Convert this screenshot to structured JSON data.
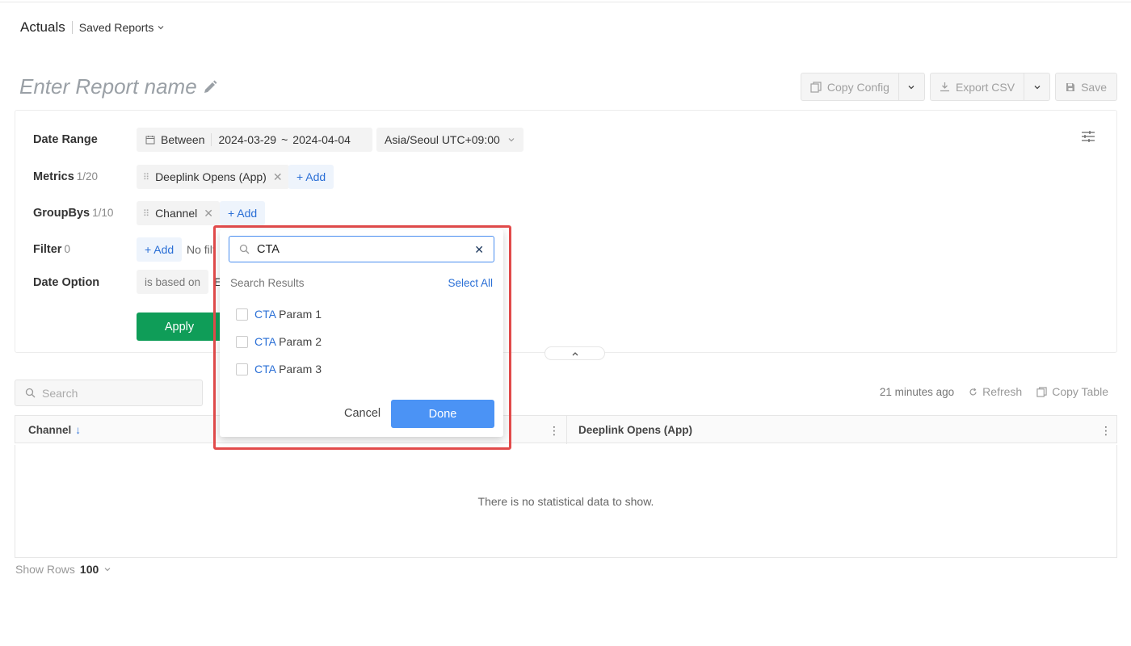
{
  "header": {
    "title": "Actuals",
    "saved_reports": "Saved Reports"
  },
  "report": {
    "name_placeholder": "Enter Report name"
  },
  "toolbar": {
    "copy_config": "Copy Config",
    "export_csv": "Export CSV",
    "save": "Save"
  },
  "config": {
    "date_range": {
      "label": "Date Range",
      "mode": "Between",
      "start": "2024-03-29",
      "tilde": "~",
      "end": "2024-04-04",
      "timezone": "Asia/Seoul UTC+09:00"
    },
    "metrics": {
      "label": "Metrics",
      "count": "1/20",
      "items": [
        "Deeplink Opens (App)"
      ],
      "add": "+ Add"
    },
    "groupbys": {
      "label": "GroupBys",
      "count": "1/10",
      "items": [
        "Channel"
      ],
      "add": "+ Add"
    },
    "filter": {
      "label": "Filter",
      "count": "0",
      "add": "+ Add",
      "empty": "No filt"
    },
    "date_option": {
      "label": "Date Option",
      "based_on": "is based on",
      "value": "E"
    },
    "apply": "Apply"
  },
  "table": {
    "search_placeholder": "Search",
    "updated": "21 minutes ago",
    "refresh": "Refresh",
    "copy_table": "Copy Table",
    "columns": [
      "Channel",
      "Deeplink Opens (App)"
    ],
    "sort_indicator": "↓",
    "empty": "There is no statistical data to show.",
    "show_rows_label": "Show Rows",
    "show_rows_value": "100"
  },
  "popover": {
    "search_value": "CTA",
    "subtitle": "Search Results",
    "select_all": "Select All",
    "options": [
      {
        "match": "CTA",
        "rest": "Param 1"
      },
      {
        "match": "CTA",
        "rest": "Param 2"
      },
      {
        "match": "CTA",
        "rest": "Param 3"
      }
    ],
    "cancel": "Cancel",
    "done": "Done"
  },
  "colors": {
    "primary_blue": "#4b93f5",
    "link_blue": "#2a6fd6",
    "apply_green": "#0f9d58",
    "highlight_red": "#e24b4b"
  }
}
